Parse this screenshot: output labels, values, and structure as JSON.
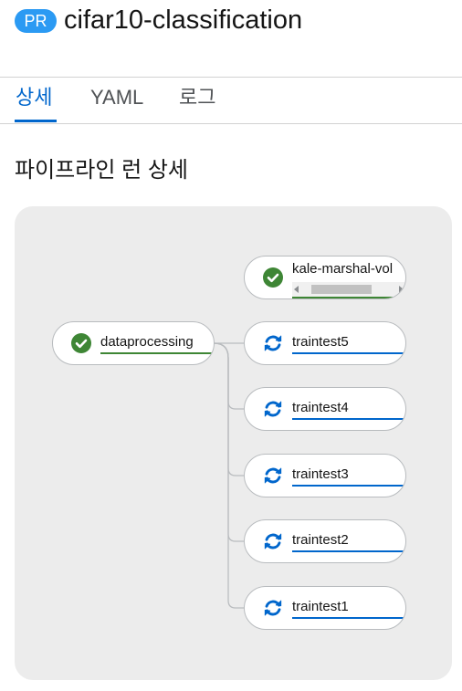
{
  "header": {
    "badge": "PR",
    "title": "cifar10-classification"
  },
  "tabs": [
    {
      "label": "상세",
      "active": true
    },
    {
      "label": "YAML",
      "active": false
    },
    {
      "label": "로그",
      "active": false
    }
  ],
  "section_title": "파이프라인 런 상세",
  "graph": {
    "nodes": [
      {
        "label": "kale-marshal-vol",
        "status": "succeeded"
      },
      {
        "label": "dataprocessing",
        "status": "succeeded"
      },
      {
        "label": "traintest5",
        "status": "running"
      },
      {
        "label": "traintest4",
        "status": "running"
      },
      {
        "label": "traintest3",
        "status": "running"
      },
      {
        "label": "traintest2",
        "status": "running"
      },
      {
        "label": "traintest1",
        "status": "running"
      }
    ]
  },
  "colors": {
    "accent": "#0066cc",
    "badge": "#2b9af3",
    "success": "#3e8635",
    "canvas": "#ececec"
  }
}
